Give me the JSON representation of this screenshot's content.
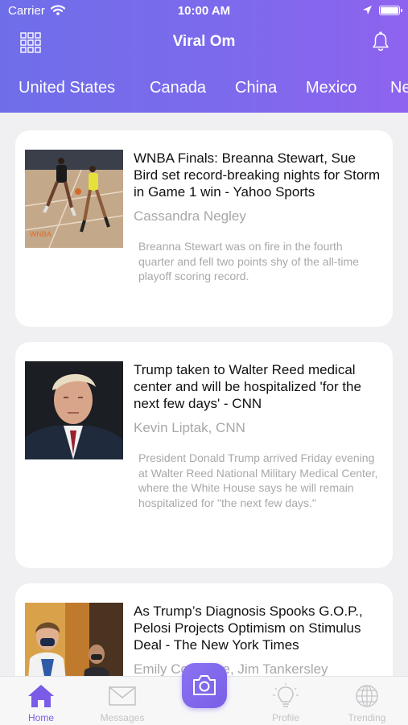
{
  "status_bar": {
    "carrier": "Carrier",
    "time": "10:00 AM"
  },
  "navbar": {
    "title": "Viral Om"
  },
  "tabs": [
    "United States",
    "Canada",
    "China",
    "Mexico",
    "Ne"
  ],
  "articles": [
    {
      "headline": "WNBA Finals: Breanna Stewart, Sue Bird set record-breaking nights for Storm in Game 1 win - Yahoo Sports",
      "author": "Cassandra Negley",
      "summary": "Breanna Stewart was on fire in the fourth quarter and fell two points shy of the all-time playoff scoring record."
    },
    {
      "headline": "Trump taken to Walter Reed medical center and will be hospitalized 'for the next few days' - CNN",
      "author": "Kevin Liptak, CNN",
      "summary": "President Donald Trump arrived Friday evening at Walter Reed National Military Medical Center, where the White House says he will remain hospitalized for \"the next few days.\""
    },
    {
      "headline": "As Trump’s Diagnosis Spooks G.O.P., Pelosi Projects Optimism on Stimulus Deal - The New York Times",
      "author": "Emily Cochrane, Jim Tankersley",
      "summary": ""
    }
  ],
  "tabbar": {
    "home": "Home",
    "messages": "Messages",
    "profile": "Profile",
    "trending": "Trending"
  },
  "colors": {
    "accent": "#7a6cec",
    "active_tab": "#7b5ce6",
    "inactive_tab": "#c4c4c8"
  },
  "icons": [
    "wifi-icon",
    "location-arrow-icon",
    "battery-icon",
    "grid-menu-icon",
    "bell-icon",
    "home-icon",
    "envelope-icon",
    "camera-icon",
    "lightbulb-icon",
    "globe-icon"
  ]
}
